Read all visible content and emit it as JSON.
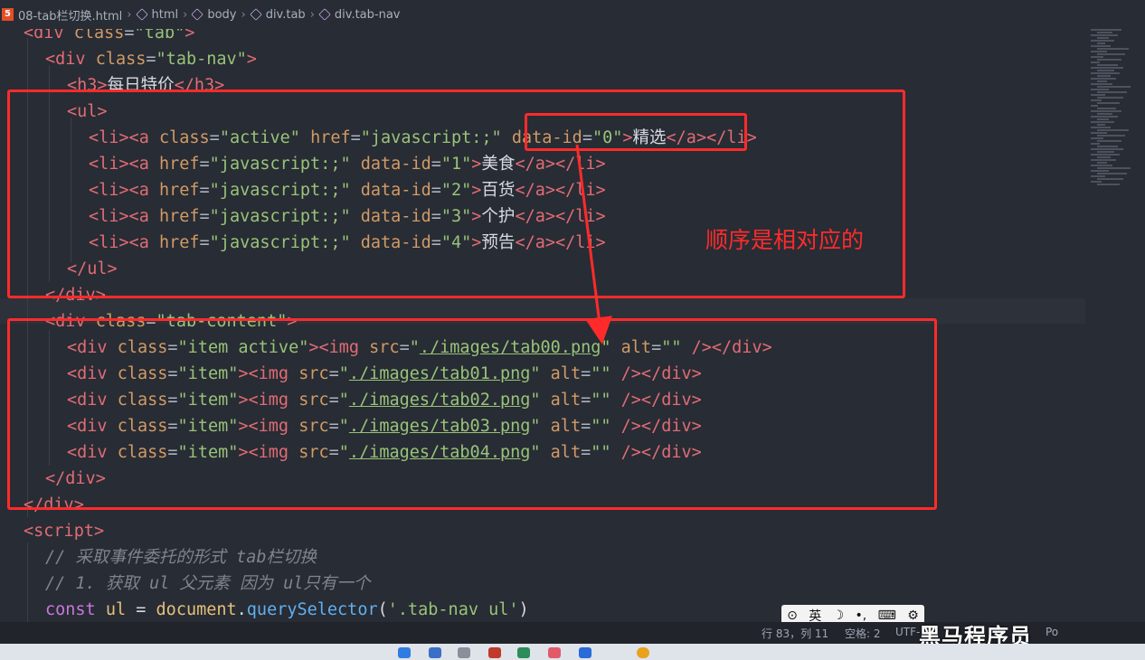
{
  "breadcrumb": {
    "file": "08-tab栏切换.html",
    "items": [
      "html",
      "body",
      "div.tab",
      "div.tab-nav"
    ]
  },
  "code_lines": [
    [
      [
        "tag",
        "<div "
      ],
      [
        "attr",
        "class"
      ],
      [
        "pun",
        "="
      ],
      [
        "str",
        "\"tab\""
      ],
      [
        "tag",
        ">"
      ]
    ],
    [
      [
        "tag",
        "<div "
      ],
      [
        "attr",
        "class"
      ],
      [
        "pun",
        "="
      ],
      [
        "str",
        "\"tab-nav\""
      ],
      [
        "tag",
        ">"
      ]
    ],
    [
      [
        "tag",
        "<h3>"
      ],
      [
        "txt",
        "每日特价"
      ],
      [
        "tag",
        "</h3>"
      ]
    ],
    [
      [
        "tag",
        "<ul>"
      ]
    ],
    [
      [
        "tag",
        "<li><a "
      ],
      [
        "attr",
        "class"
      ],
      [
        "pun",
        "="
      ],
      [
        "str",
        "\"active\""
      ],
      [
        "pun",
        " "
      ],
      [
        "attr",
        "href"
      ],
      [
        "pun",
        "="
      ],
      [
        "str",
        "\"javascript:;\""
      ],
      [
        "pun",
        " "
      ],
      [
        "attr",
        "data-id"
      ],
      [
        "pun",
        "="
      ],
      [
        "str",
        "\"0\""
      ],
      [
        "tag",
        ">"
      ],
      [
        "txt",
        "精选"
      ],
      [
        "tag",
        "</a></li>"
      ]
    ],
    [
      [
        "tag",
        "<li><a "
      ],
      [
        "attr",
        "href"
      ],
      [
        "pun",
        "="
      ],
      [
        "str",
        "\"javascript:;\""
      ],
      [
        "pun",
        " "
      ],
      [
        "attr",
        "data-id"
      ],
      [
        "pun",
        "="
      ],
      [
        "str",
        "\"1\""
      ],
      [
        "tag",
        ">"
      ],
      [
        "txt",
        "美食"
      ],
      [
        "tag",
        "</a></li>"
      ]
    ],
    [
      [
        "tag",
        "<li><a "
      ],
      [
        "attr",
        "href"
      ],
      [
        "pun",
        "="
      ],
      [
        "str",
        "\"javascript:;\""
      ],
      [
        "pun",
        " "
      ],
      [
        "attr",
        "data-id"
      ],
      [
        "pun",
        "="
      ],
      [
        "str",
        "\"2\""
      ],
      [
        "tag",
        ">"
      ],
      [
        "txt",
        "百货"
      ],
      [
        "tag",
        "</a></li>"
      ]
    ],
    [
      [
        "tag",
        "<li><a "
      ],
      [
        "attr",
        "href"
      ],
      [
        "pun",
        "="
      ],
      [
        "str",
        "\"javascript:;\""
      ],
      [
        "pun",
        " "
      ],
      [
        "attr",
        "data-id"
      ],
      [
        "pun",
        "="
      ],
      [
        "str",
        "\"3\""
      ],
      [
        "tag",
        ">"
      ],
      [
        "txt",
        "个护"
      ],
      [
        "tag",
        "</a></li>"
      ]
    ],
    [
      [
        "tag",
        "<li><a "
      ],
      [
        "attr",
        "href"
      ],
      [
        "pun",
        "="
      ],
      [
        "str",
        "\"javascript:;\""
      ],
      [
        "pun",
        " "
      ],
      [
        "attr",
        "data-id"
      ],
      [
        "pun",
        "="
      ],
      [
        "str",
        "\"4\""
      ],
      [
        "tag",
        ">"
      ],
      [
        "txt",
        "预告"
      ],
      [
        "tag",
        "</a></li>"
      ]
    ],
    [
      [
        "tag",
        "</ul>"
      ]
    ],
    [
      [
        "tag",
        "</div>"
      ]
    ],
    [
      [
        "tag",
        "<div "
      ],
      [
        "attr",
        "class"
      ],
      [
        "pun",
        "="
      ],
      [
        "str",
        "\"tab-content\""
      ],
      [
        "tag",
        ">"
      ]
    ],
    [
      [
        "tag",
        "<div "
      ],
      [
        "attr",
        "class"
      ],
      [
        "pun",
        "="
      ],
      [
        "str",
        "\"item active\""
      ],
      [
        "tag",
        "><img "
      ],
      [
        "attr",
        "src"
      ],
      [
        "pun",
        "="
      ],
      [
        "str",
        "\""
      ],
      [
        "str ul",
        "./images/tab00.png"
      ],
      [
        "str",
        "\""
      ],
      [
        "pun",
        " "
      ],
      [
        "attr",
        "alt"
      ],
      [
        "pun",
        "="
      ],
      [
        "str",
        "\"\""
      ],
      [
        "tag",
        " /></div>"
      ]
    ],
    [
      [
        "tag",
        "<div "
      ],
      [
        "attr",
        "class"
      ],
      [
        "pun",
        "="
      ],
      [
        "str",
        "\"item\""
      ],
      [
        "tag",
        "><img "
      ],
      [
        "attr",
        "src"
      ],
      [
        "pun",
        "="
      ],
      [
        "str",
        "\""
      ],
      [
        "str ul",
        "./images/tab01.png"
      ],
      [
        "str",
        "\""
      ],
      [
        "pun",
        " "
      ],
      [
        "attr",
        "alt"
      ],
      [
        "pun",
        "="
      ],
      [
        "str",
        "\"\""
      ],
      [
        "tag",
        " /></div>"
      ]
    ],
    [
      [
        "tag",
        "<div "
      ],
      [
        "attr",
        "class"
      ],
      [
        "pun",
        "="
      ],
      [
        "str",
        "\"item\""
      ],
      [
        "tag",
        "><img "
      ],
      [
        "attr",
        "src"
      ],
      [
        "pun",
        "="
      ],
      [
        "str",
        "\""
      ],
      [
        "str ul",
        "./images/tab02.png"
      ],
      [
        "str",
        "\""
      ],
      [
        "pun",
        " "
      ],
      [
        "attr",
        "alt"
      ],
      [
        "pun",
        "="
      ],
      [
        "str",
        "\"\""
      ],
      [
        "tag",
        " /></div>"
      ]
    ],
    [
      [
        "tag",
        "<div "
      ],
      [
        "attr",
        "class"
      ],
      [
        "pun",
        "="
      ],
      [
        "str",
        "\"item\""
      ],
      [
        "tag",
        "><img "
      ],
      [
        "attr",
        "src"
      ],
      [
        "pun",
        "="
      ],
      [
        "str",
        "\""
      ],
      [
        "str ul",
        "./images/tab03.png"
      ],
      [
        "str",
        "\""
      ],
      [
        "pun",
        " "
      ],
      [
        "attr",
        "alt"
      ],
      [
        "pun",
        "="
      ],
      [
        "str",
        "\"\""
      ],
      [
        "tag",
        " /></div>"
      ]
    ],
    [
      [
        "tag",
        "<div "
      ],
      [
        "attr",
        "class"
      ],
      [
        "pun",
        "="
      ],
      [
        "str",
        "\"item\""
      ],
      [
        "tag",
        "><img "
      ],
      [
        "attr",
        "src"
      ],
      [
        "pun",
        "="
      ],
      [
        "str",
        "\""
      ],
      [
        "str ul",
        "./images/tab04.png"
      ],
      [
        "str",
        "\""
      ],
      [
        "pun",
        " "
      ],
      [
        "attr",
        "alt"
      ],
      [
        "pun",
        "="
      ],
      [
        "str",
        "\"\""
      ],
      [
        "tag",
        " /></div>"
      ]
    ],
    [
      [
        "tag",
        "</div>"
      ]
    ],
    [
      [
        "tag",
        "</div>"
      ]
    ],
    [
      [
        "tag",
        "<script>"
      ]
    ],
    [
      [
        "cmt",
        "// 采取事件委托的形式 tab栏切换"
      ]
    ],
    [
      [
        "cmt",
        "// 1. 获取 ul 父元素 因为 ul只有一个"
      ]
    ],
    [
      [
        "kw",
        "const"
      ],
      [
        "plain",
        " "
      ],
      [
        "var",
        "ul"
      ],
      [
        "plain",
        " = "
      ],
      [
        "var",
        "document"
      ],
      [
        "plain",
        "."
      ],
      [
        "fn",
        "querySelector"
      ],
      [
        "plain",
        "("
      ],
      [
        "str",
        "'.tab-nav ul'"
      ],
      [
        "plain",
        ")"
      ]
    ]
  ],
  "annotation": {
    "note": "顺序是相对应的"
  },
  "ime_bar": {
    "mode": "英",
    "icons": [
      "ime-logo-icon",
      "moon-icon",
      "punctuation-icon",
      "keyboard-icon",
      "gear-icon"
    ]
  },
  "status_bar": {
    "position": "行 83，列 11",
    "indent": "空格: 2",
    "encoding": "UTF-",
    "extra": "Po"
  },
  "watermark": "黑马程序员",
  "colors": {
    "annotation": "#ff2b2b",
    "editor_bg": "#282c34"
  }
}
